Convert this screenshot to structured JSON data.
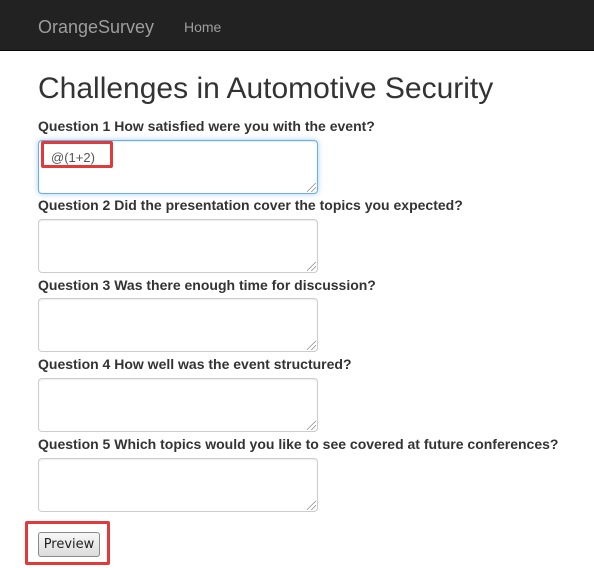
{
  "navbar": {
    "brand": "OrangeSurvey",
    "home_label": "Home"
  },
  "page": {
    "title": "Challenges in Automotive Security"
  },
  "questions": [
    {
      "label": "Question 1 How satisfied were you with the event?",
      "value": "@(1+2)"
    },
    {
      "label": "Question 2 Did the presentation cover the topics you expected?",
      "value": ""
    },
    {
      "label": "Question 3 Was there enough time for discussion?",
      "value": ""
    },
    {
      "label": "Question 4 How well was the event structured?",
      "value": ""
    },
    {
      "label": "Question 5 Which topics would you like to see covered at future conferences?",
      "value": ""
    }
  ],
  "form": {
    "preview_label": "Preview"
  },
  "colors": {
    "navbar_bg": "#222222",
    "highlight": "#e03a3a",
    "focus_border": "#66afe9"
  }
}
